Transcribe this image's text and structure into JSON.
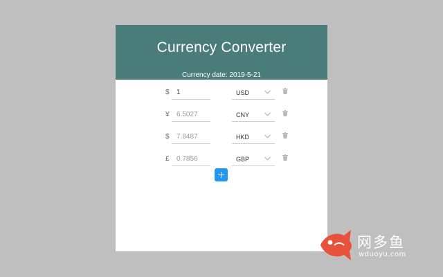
{
  "header": {
    "title": "Currency Converter",
    "date_label": "Currency date: 2019-5-21"
  },
  "rows": [
    {
      "symbol": "$",
      "amount": "1",
      "currency": "USD"
    },
    {
      "symbol": "¥",
      "amount": "6.5027",
      "currency": "CNY"
    },
    {
      "symbol": "$",
      "amount": "7.8487",
      "currency": "HKD"
    },
    {
      "symbol": "£",
      "amount": "0.7856",
      "currency": "GBP"
    }
  ],
  "icons": {
    "dropdown": "chevron-down-icon",
    "delete": "trash-icon",
    "add": "plus-icon"
  },
  "watermark": {
    "name": "网多鱼",
    "url": "wduoyu.com"
  },
  "colors": {
    "header_bg": "#4a7c7a",
    "add_button": "#2196f3",
    "page_bg": "#bfbfbf",
    "watermark_fish": "#e8513a"
  }
}
